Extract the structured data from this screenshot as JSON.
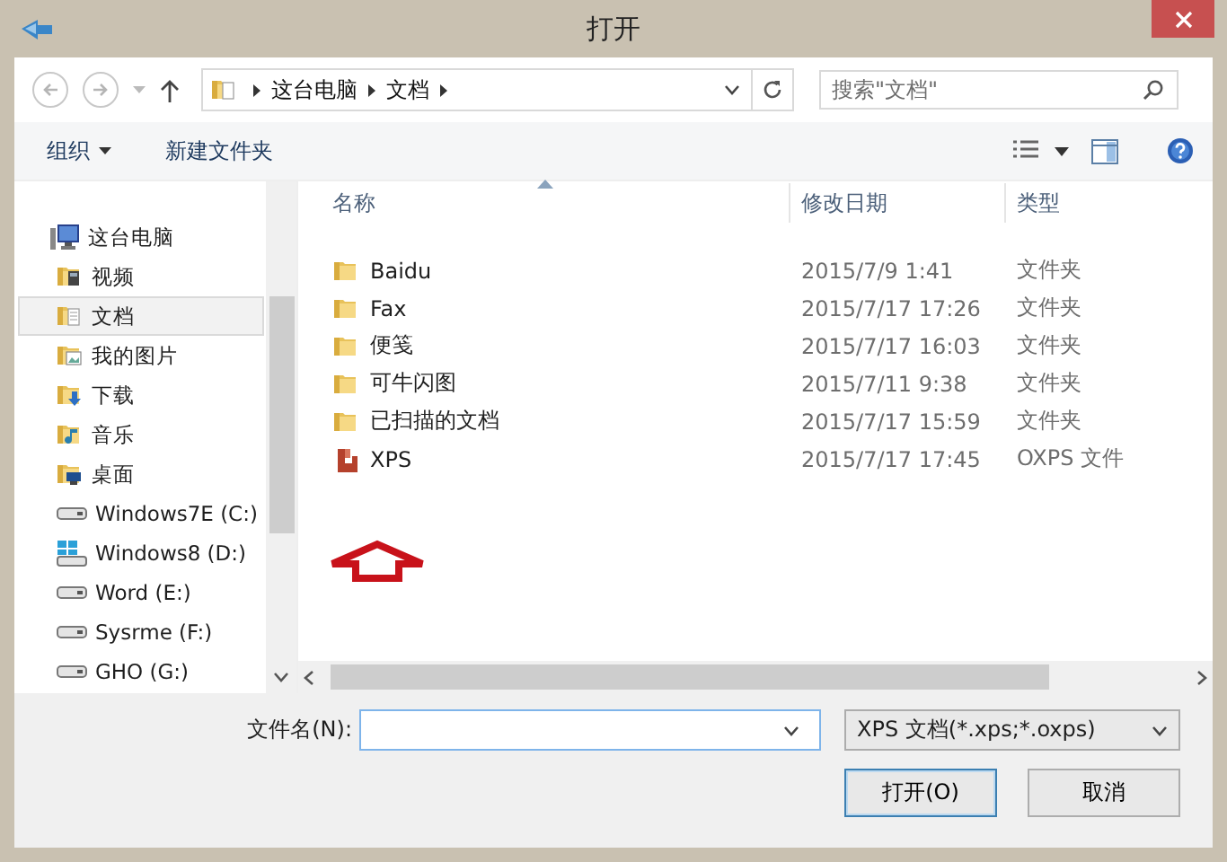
{
  "window": {
    "title": "打开"
  },
  "address": {
    "crumbs": [
      "这台电脑",
      "文档"
    ]
  },
  "search": {
    "placeholder": "搜索\"文档\""
  },
  "toolbar": {
    "organize": "组织",
    "new_folder": "新建文件夹"
  },
  "sidebar": {
    "items": [
      {
        "label": "这台电脑",
        "kind": "computer",
        "selected": false,
        "children": [
          {
            "label": "视频",
            "kind": "videos",
            "selected": false
          },
          {
            "label": "文档",
            "kind": "documents",
            "selected": true
          },
          {
            "label": "我的图片",
            "kind": "pictures",
            "selected": false
          },
          {
            "label": "下载",
            "kind": "downloads",
            "selected": false
          },
          {
            "label": "音乐",
            "kind": "music",
            "selected": false
          },
          {
            "label": "桌面",
            "kind": "desktop",
            "selected": false
          },
          {
            "label": "Windows7E (C:)",
            "kind": "drive",
            "selected": false
          },
          {
            "label": "Windows8 (D:)",
            "kind": "system-drive",
            "selected": false
          },
          {
            "label": "Word (E:)",
            "kind": "drive",
            "selected": false
          },
          {
            "label": "Sysrme (F:)",
            "kind": "drive",
            "selected": false
          },
          {
            "label": "GHO (G:)",
            "kind": "drive",
            "selected": false
          }
        ]
      }
    ]
  },
  "table": {
    "columns": [
      {
        "label": "名称",
        "sorted": true
      },
      {
        "label": "修改日期",
        "sorted": false
      },
      {
        "label": "类型",
        "sorted": false
      }
    ],
    "rows": [
      {
        "name": "Baidu",
        "date": "2015/7/9 1:41",
        "type": "文件夹",
        "kind": "folder"
      },
      {
        "name": "Fax",
        "date": "2015/7/17 17:26",
        "type": "文件夹",
        "kind": "folder"
      },
      {
        "name": "便笺",
        "date": "2015/7/17 16:03",
        "type": "文件夹",
        "kind": "folder"
      },
      {
        "name": "可牛闪图",
        "date": "2015/7/11 9:38",
        "type": "文件夹",
        "kind": "folder"
      },
      {
        "name": "已扫描的文档",
        "date": "2015/7/17 15:59",
        "type": "文件夹",
        "kind": "folder"
      },
      {
        "name": "XPS",
        "date": "2015/7/17 17:45",
        "type": "OXPS 文件",
        "kind": "xps"
      }
    ]
  },
  "filename": {
    "label": "文件名(N):"
  },
  "filter": {
    "value": "XPS 文档(*.xps;*.oxps)"
  },
  "buttons": [
    {
      "label": "打开(O)",
      "default": true
    },
    {
      "label": "取消",
      "default": false
    }
  ]
}
